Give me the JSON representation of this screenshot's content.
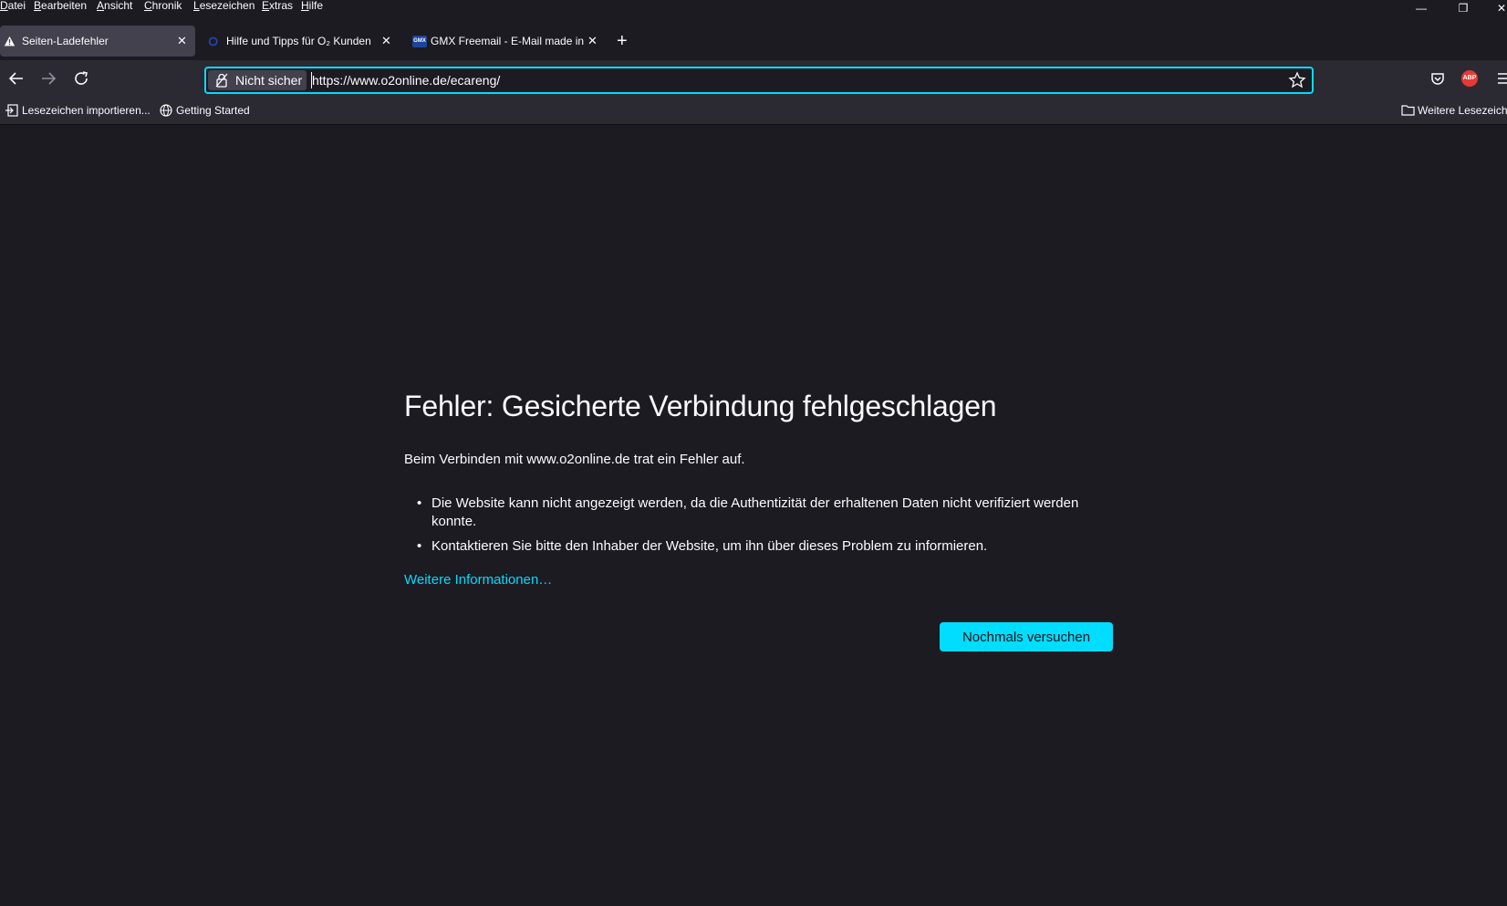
{
  "menubar": {
    "items": [
      {
        "underline": "D",
        "rest": "atei"
      },
      {
        "underline": "B",
        "rest": "earbeiten"
      },
      {
        "underline": "A",
        "rest": "nsicht"
      },
      {
        "underline": "C",
        "rest": "hronik"
      },
      {
        "underline": "L",
        "rest": "esezeichen"
      },
      {
        "underline": "E",
        "rest": "xtras"
      },
      {
        "underline": "H",
        "rest": "ilfe"
      }
    ],
    "window_controls": {
      "minimize": "—",
      "restore": "❐",
      "close": "✕"
    }
  },
  "tabs": [
    {
      "title": "Seiten-Ladefehler",
      "close": "✕",
      "icon": "warning-icon",
      "active": true
    },
    {
      "title": "Hilfe und Tipps für O₂ Kunden",
      "close": "✕",
      "icon": "o2-logo-icon",
      "active": false
    },
    {
      "title": "GMX Freemail - E-Mail made in",
      "close": "✕",
      "icon": "gmx-logo-icon",
      "active": false
    }
  ],
  "new_tab_label": "+",
  "gmx_badge": "GMX",
  "navbar": {
    "security_label": "Nicht sicher",
    "url": "https://www.o2online.de/ecareng/",
    "abp_badge": "ABP"
  },
  "bookmarks": {
    "import": "Lesezeichen importieren...",
    "getting_started": "Getting Started",
    "more": "Weitere Lesezeichen"
  },
  "error": {
    "title": "Fehler: Gesicherte Verbindung fehlgeschlagen",
    "intro": "Beim Verbinden mit www.o2online.de trat ein Fehler auf.",
    "bullets": [
      "Die Website kann nicht angezeigt werden, da die Authentizität der erhaltenen Daten nicht verifiziert werden konnte.",
      "Kontaktieren Sie bitte den Inhaber der Website, um ihn über dieses Problem zu informieren."
    ],
    "more_info": "Weitere Informationen…",
    "retry_button": "Nochmals versuchen"
  },
  "colors": {
    "accent": "#00ddff",
    "background": "#1c1b22",
    "toolbar": "#2b2a33",
    "active_tab": "#42414d",
    "abp_red": "#e53935"
  }
}
